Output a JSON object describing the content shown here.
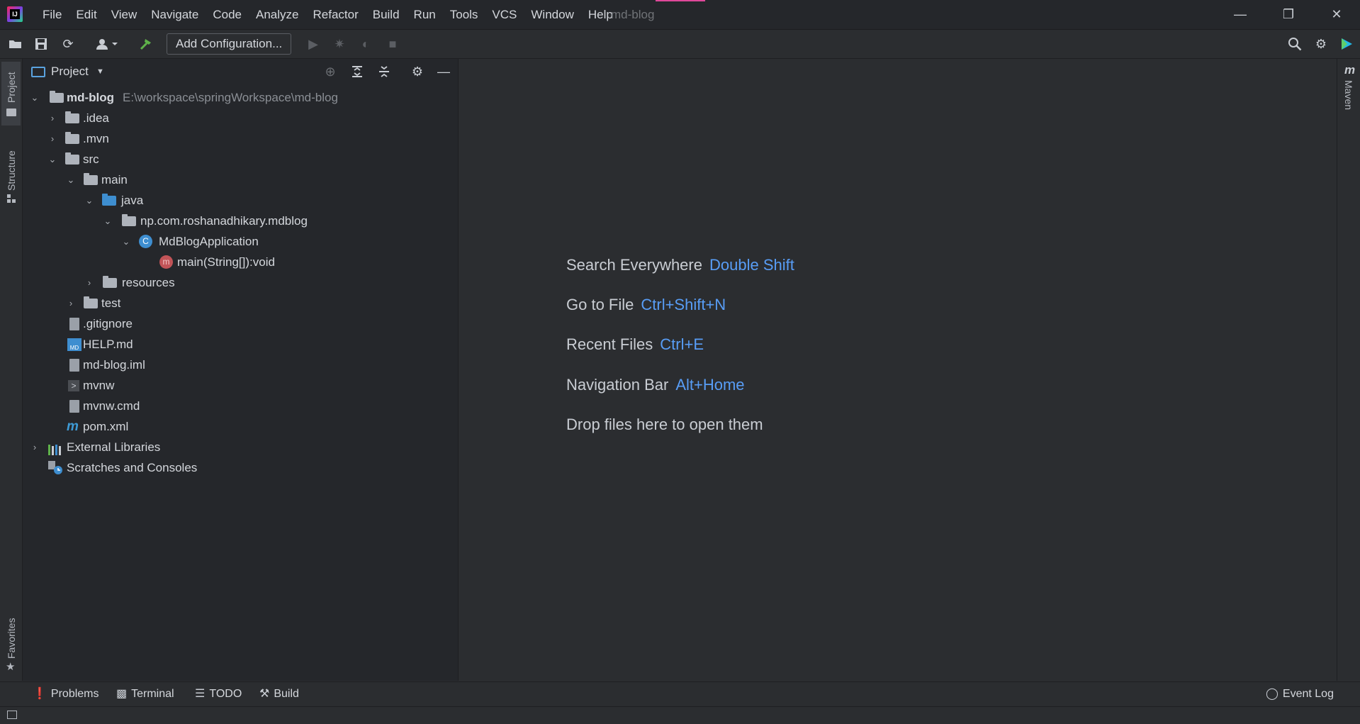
{
  "title_bar": {
    "menus": [
      "File",
      "Edit",
      "View",
      "Navigate",
      "Code",
      "Analyze",
      "Refactor",
      "Build",
      "Run",
      "Tools",
      "VCS",
      "Window",
      "Help"
    ],
    "window_title": "md-blog"
  },
  "toolbar": {
    "add_configuration": "Add Configuration..."
  },
  "left_stripe": {
    "project": "Project",
    "structure": "Structure",
    "favorites": "Favorites"
  },
  "right_stripe": {
    "maven": "Maven"
  },
  "project_panel": {
    "title": "Project",
    "tree": [
      {
        "label": "md-blog",
        "path": "E:\\workspace\\springWorkspace\\md-blog"
      },
      {
        "label": ".idea"
      },
      {
        "label": ".mvn"
      },
      {
        "label": "src"
      },
      {
        "label": "main"
      },
      {
        "label": "java"
      },
      {
        "label": "np.com.roshanadhikary.mdblog"
      },
      {
        "label": "MdBlogApplication"
      },
      {
        "label": "main(String[]):void"
      },
      {
        "label": "resources"
      },
      {
        "label": "test"
      },
      {
        "label": ".gitignore"
      },
      {
        "label": "HELP.md"
      },
      {
        "label": "md-blog.iml"
      },
      {
        "label": "mvnw"
      },
      {
        "label": "mvnw.cmd"
      },
      {
        "label": "pom.xml"
      },
      {
        "label": "External Libraries"
      },
      {
        "label": "Scratches and Consoles"
      }
    ]
  },
  "editor_hints": [
    {
      "text": "Search Everywhere",
      "key": "Double Shift"
    },
    {
      "text": "Go to File",
      "key": "Ctrl+Shift+N"
    },
    {
      "text": "Recent Files",
      "key": "Ctrl+E"
    },
    {
      "text": "Navigation Bar",
      "key": "Alt+Home"
    },
    {
      "text": "Drop files here to open them",
      "key": ""
    }
  ],
  "bottom_tools": {
    "problems": "Problems",
    "terminal": "Terminal",
    "todo": "TODO",
    "build": "Build",
    "event_log": "Event Log"
  },
  "colors": {
    "accent": "#589df6",
    "folder_blue": "#3e8ed0"
  }
}
